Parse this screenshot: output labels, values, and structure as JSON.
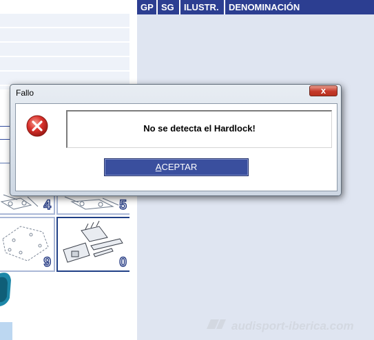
{
  "table_header": {
    "columns": [
      "GP",
      "SG",
      "ILUSTR.",
      "DENOMINACIÓN"
    ]
  },
  "thumbnails": [
    {
      "number": "4"
    },
    {
      "number": "5"
    },
    {
      "number": "9"
    },
    {
      "number": "0"
    }
  ],
  "dialog": {
    "title": "Fallo",
    "close_symbol": "x",
    "message": "No se detecta el Hardlock!",
    "ok_button_accel": "A",
    "ok_button_rest": "CEPTAR",
    "icon": "error-icon"
  },
  "watermark": {
    "text": "audisport-iberica.com"
  },
  "colors": {
    "header_bg": "#2c3e91",
    "panel_bg": "#dfe5f1",
    "button_bg": "#3a4f9e",
    "error_red": "#d9302b"
  }
}
